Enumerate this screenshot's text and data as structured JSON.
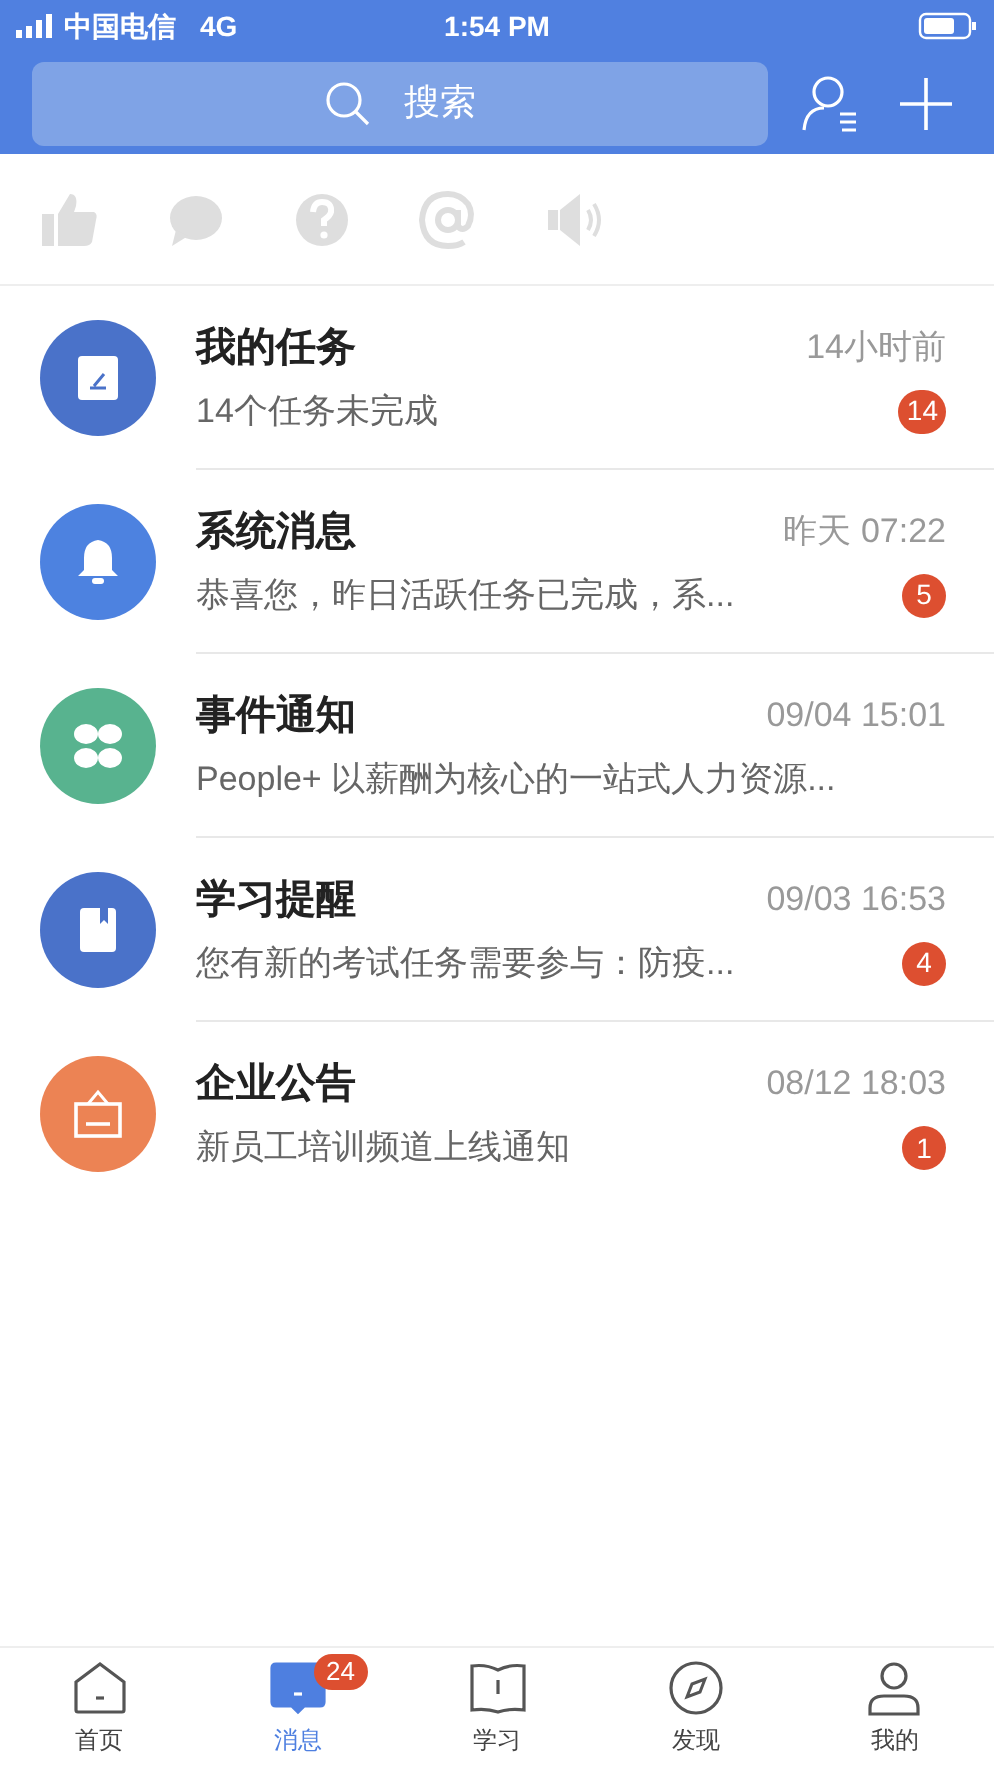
{
  "status_bar": {
    "carrier": "中国电信",
    "network": "4G",
    "time": "1:54 PM"
  },
  "search": {
    "placeholder": "搜索"
  },
  "quick_icons": [
    {
      "kind": "like"
    },
    {
      "kind": "comment"
    },
    {
      "kind": "question"
    },
    {
      "kind": "mention"
    },
    {
      "kind": "speaker"
    }
  ],
  "messages": [
    {
      "kind": "task",
      "color": "#4a72c9",
      "title": "我的任务",
      "time": "14小时前",
      "preview": "14个任务未完成",
      "badge": "14"
    },
    {
      "kind": "bell",
      "color": "#4d82e0",
      "title": "系统消息",
      "time": "昨天 07:22",
      "preview": "恭喜您，昨日活跃任务已完成，系...",
      "badge": "5"
    },
    {
      "kind": "clover",
      "color": "#58b38f",
      "title": "事件通知",
      "time": "09/04 15:01",
      "preview": "People+ 以薪酬为核心的一站式人力资源..."
    },
    {
      "kind": "book",
      "color": "#4a72c9",
      "title": "学习提醒",
      "time": "09/03 16:53",
      "preview": "您有新的考试任务需要参与：防疫...",
      "badge": "4"
    },
    {
      "kind": "sign",
      "color": "#ec8354",
      "title": "企业公告",
      "time": "08/12 18:03",
      "preview": "新员工培训频道上线通知",
      "badge": "1"
    }
  ],
  "tabs": [
    {
      "kind": "home",
      "label": "首页",
      "selected": false
    },
    {
      "kind": "message",
      "label": "消息",
      "selected": true,
      "badge": "24"
    },
    {
      "kind": "study",
      "label": "学习",
      "selected": false
    },
    {
      "kind": "discover",
      "label": "发现",
      "selected": false
    },
    {
      "kind": "me",
      "label": "我的",
      "selected": false
    }
  ]
}
